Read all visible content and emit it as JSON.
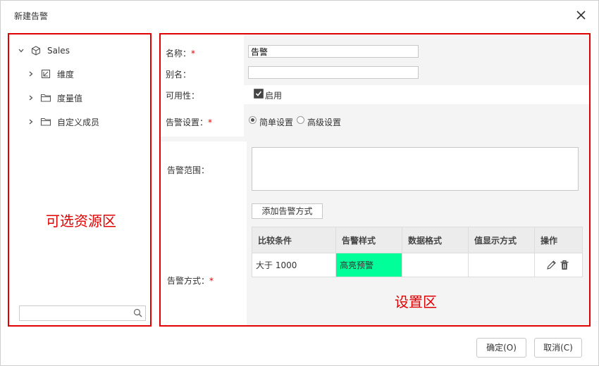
{
  "dialog": {
    "title": "新建告警"
  },
  "left_panel": {
    "tree": [
      {
        "label": "Sales",
        "icon": "cube-icon",
        "expanded": true
      },
      {
        "label": "维度",
        "icon": "dimension-icon"
      },
      {
        "label": "度量值",
        "icon": "folder-icon"
      },
      {
        "label": "自定义成员",
        "icon": "folder-icon"
      }
    ],
    "annotation": "可选资源区",
    "search": {
      "value": "",
      "placeholder": ""
    }
  },
  "form": {
    "name_label": "名称：",
    "name_value": "告警",
    "alias_label": "别名：",
    "alias_value": "",
    "availability_label": "可用性：",
    "enable_label": "启用",
    "enable_checked": true,
    "setting_label": "告警设置：",
    "simple_label": "简单设置",
    "advanced_label": "高级设置",
    "scope_label": "告警范围：",
    "method_label": "告警方式：",
    "required_mark": "*",
    "add_method_button": "添加告警方式"
  },
  "table": {
    "headers": [
      "比较条件",
      "告警样式",
      "数据格式",
      "值显示方式",
      "操作"
    ],
    "rows": [
      {
        "condition": "大于 1000",
        "style": "高亮预警",
        "style_color": "#00ff99",
        "format": "",
        "display": ""
      }
    ]
  },
  "right_panel": {
    "annotation": "设置区"
  },
  "footer": {
    "ok_label": "确定(O)",
    "cancel_label": "取消(C)"
  },
  "colors": {
    "annotation_red": "#e00000",
    "highlight_green": "#00ff99"
  }
}
